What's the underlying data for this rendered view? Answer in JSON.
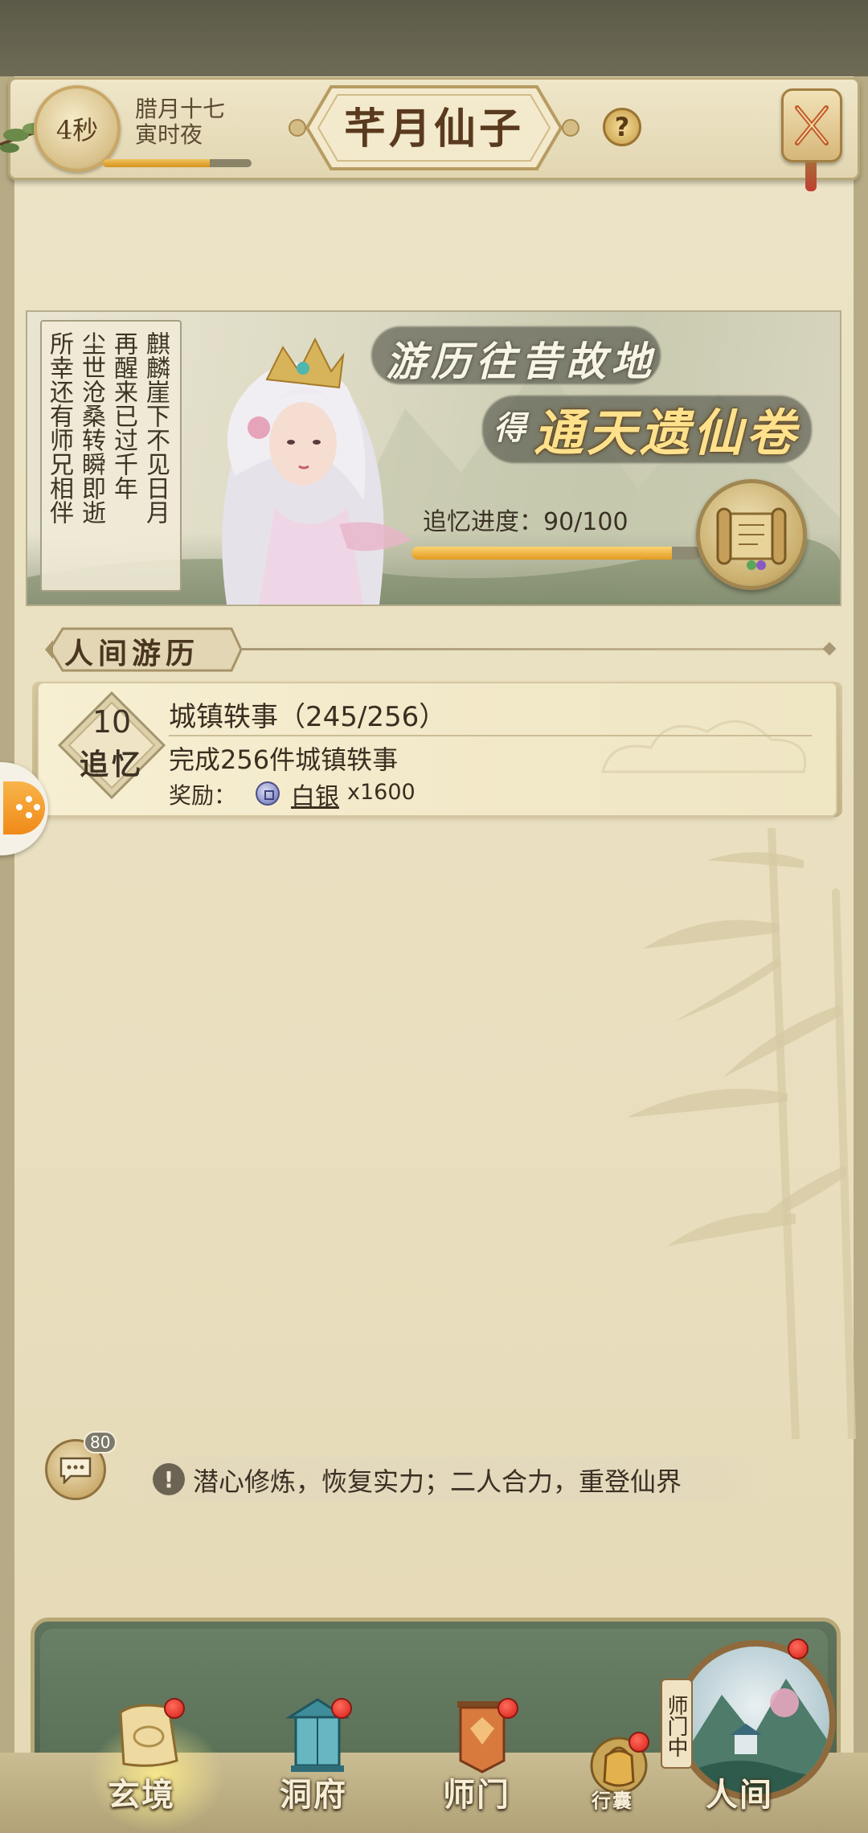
{
  "header": {
    "timer": "4秒",
    "date_month_day": "腊月十七",
    "date_hour": "寅时夜",
    "time_progress": 0.72,
    "title": "芊月仙子",
    "help_glyph": "?",
    "close_icon": "crossed-swords-icon"
  },
  "banner": {
    "poem_lines": [
      "麒麟崖下不见日月",
      "再醒来已过千年",
      "尘世沧桑转瞬即逝",
      "所幸还有师兄相伴"
    ],
    "slogan_line1": "游历往昔故地",
    "slogan_de": "得",
    "slogan_line2": "通天遗仙卷",
    "progress_label": "追忆进度：90/100",
    "progress_current": 90,
    "progress_max": 100,
    "reward_icon": "scroll-icon"
  },
  "section": {
    "title": "人间游历"
  },
  "tasks": [
    {
      "badge_number": "10",
      "badge_label": "追忆",
      "title": "城镇轶事（245/256）",
      "description": "完成256件城镇轶事",
      "reward_label": "奖励：",
      "reward_icon": "silver-coin-icon",
      "reward_name": "白银",
      "reward_qty": "x1600"
    }
  ],
  "chat": {
    "count": "80",
    "icon": "chat-bubble-icon"
  },
  "hint": {
    "icon": "exclamation-icon",
    "text": "潜心修炼，恢复实力；二人合力，重登仙界"
  },
  "nav": {
    "items": [
      {
        "label": "玄境",
        "icon": "scroll-icon",
        "active": true
      },
      {
        "label": "洞府",
        "icon": "pavilion-lantern-icon"
      },
      {
        "label": "师门",
        "icon": "banner-flag-icon"
      },
      {
        "label": "行囊",
        "icon": "pouch-icon"
      },
      {
        "label": "人间",
        "icon": "mountain-town-icon"
      }
    ],
    "master_tag": "师门中"
  },
  "colors": {
    "accent_gold": "#e39a22",
    "panel_green": "#52684f",
    "notification_red": "#d6201a"
  }
}
